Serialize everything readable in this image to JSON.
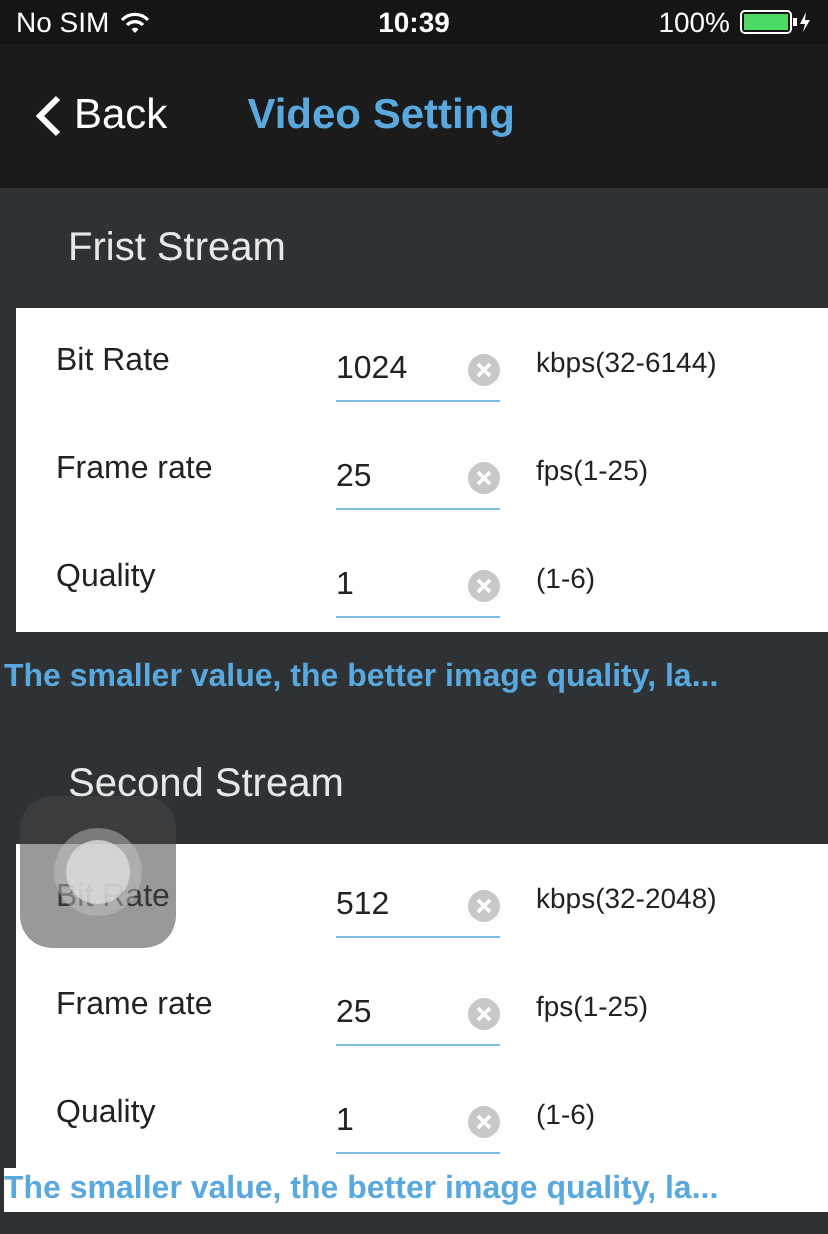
{
  "status_bar": {
    "carrier": "No SIM",
    "time": "10:39",
    "battery": "100%"
  },
  "nav": {
    "back": "Back",
    "title": "Video Setting"
  },
  "streams": [
    {
      "title": "Frist Stream",
      "fields": [
        {
          "label": "Bit Rate",
          "value": "1024",
          "range": "kbps(32-6144)"
        },
        {
          "label": "Frame rate",
          "value": "25",
          "range": "fps(1-25)"
        },
        {
          "label": "Quality",
          "value": "1",
          "range": "(1-6)"
        }
      ],
      "note": "The smaller value, the better image quality, la..."
    },
    {
      "title": "Second Stream",
      "fields": [
        {
          "label": "Bit Rate",
          "value": "512",
          "range": "kbps(32-2048)"
        },
        {
          "label": "Frame rate",
          "value": "25",
          "range": "fps(1-25)"
        },
        {
          "label": "Quality",
          "value": "1",
          "range": "(1-6)"
        }
      ],
      "note": "The smaller value, the better image quality, la..."
    }
  ]
}
